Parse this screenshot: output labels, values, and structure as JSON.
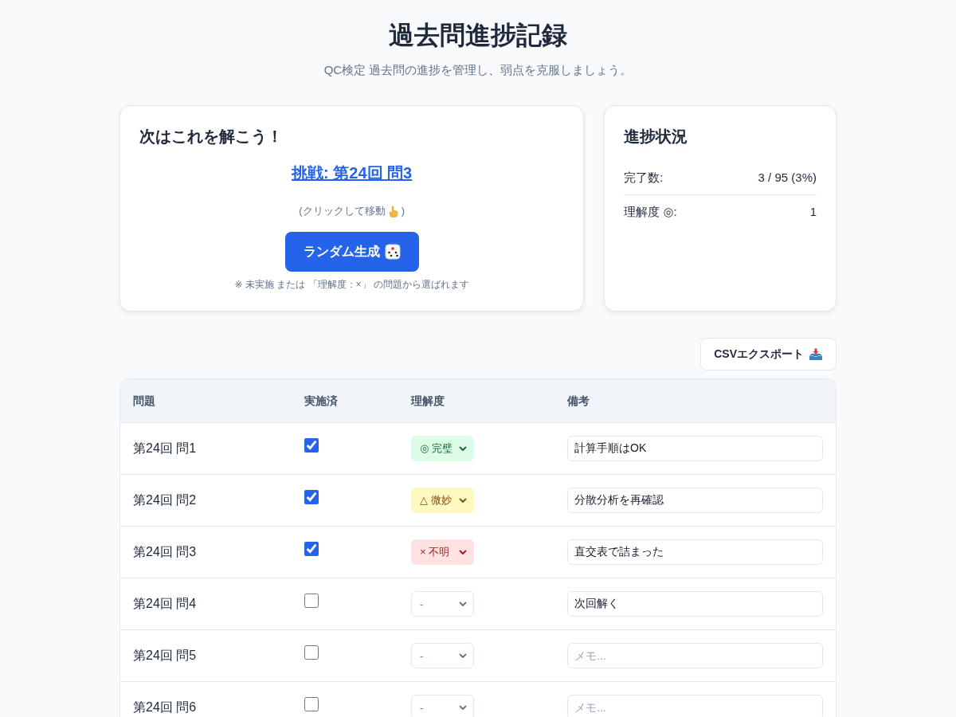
{
  "header": {
    "title": "過去問進捗記録",
    "subtitle": "QC検定 過去問の進捗を管理し、弱点を克服しましょう。"
  },
  "next_card": {
    "title": "次はこれを解こう！",
    "challenge_link": "挑戦: 第24回 問3",
    "hint": {
      "before": "(クリックして移動",
      "after": ")"
    },
    "random_button": "ランダム生成",
    "note": "※ 未実施 または 「理解度：×」 の問題から選ばれます"
  },
  "progress_card": {
    "title": "進捗状況",
    "stats": [
      {
        "label": "完了数:",
        "value": "3 / 95 (3%)"
      },
      {
        "label": "理解度 ◎:",
        "value": "1"
      }
    ]
  },
  "export_button": "CSVエクスポート",
  "table": {
    "columns": [
      "問題",
      "実施済",
      "理解度",
      "備考"
    ],
    "rows": [
      {
        "problem": "第24回 問1",
        "done": true,
        "kind": "perfect",
        "understanding": "◎ 完璧",
        "memo": "計算手順はOK"
      },
      {
        "problem": "第24回 問2",
        "done": true,
        "kind": "unsure",
        "understanding": "△ 微妙",
        "memo": "分散分析を再確認"
      },
      {
        "problem": "第24回 問3",
        "done": true,
        "kind": "unknown",
        "understanding": "× 不明",
        "memo": "直交表で詰まった"
      },
      {
        "problem": "第24回 問4",
        "done": false,
        "kind": "unset",
        "understanding": "-",
        "memo": "次回解く"
      },
      {
        "problem": "第24回 問5",
        "done": false,
        "kind": "unset",
        "understanding": "-",
        "placeholder": "メモ..."
      },
      {
        "problem": "第24回 問6",
        "done": false,
        "kind": "unset",
        "understanding": "-",
        "placeholder": "メモ..."
      }
    ]
  }
}
